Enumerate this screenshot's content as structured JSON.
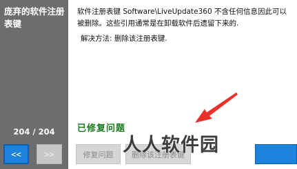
{
  "sidebar": {
    "title": "庞弃的软件注册表键",
    "counter": "204 / 204",
    "prev_label": "<<",
    "next_label": ">>"
  },
  "content": {
    "description": "软件注册表键 Software\\LiveUpdate360 不含任何信息因此可以被删除。这些引用通常是在卸载软件后遗留下来的.",
    "solution": "解决方法: 删除该注册表键.",
    "status": "已修复问题"
  },
  "buttons": {
    "fix_label": "修复问题",
    "delete_label": "删除该注册表键"
  },
  "watermark": "人人软件园",
  "colors": {
    "sidebar_bg": "#6d6d6d",
    "accent_blue": "#1c84dc",
    "status_green": "#1b7a1f",
    "arrow_red": "#e8322b"
  }
}
